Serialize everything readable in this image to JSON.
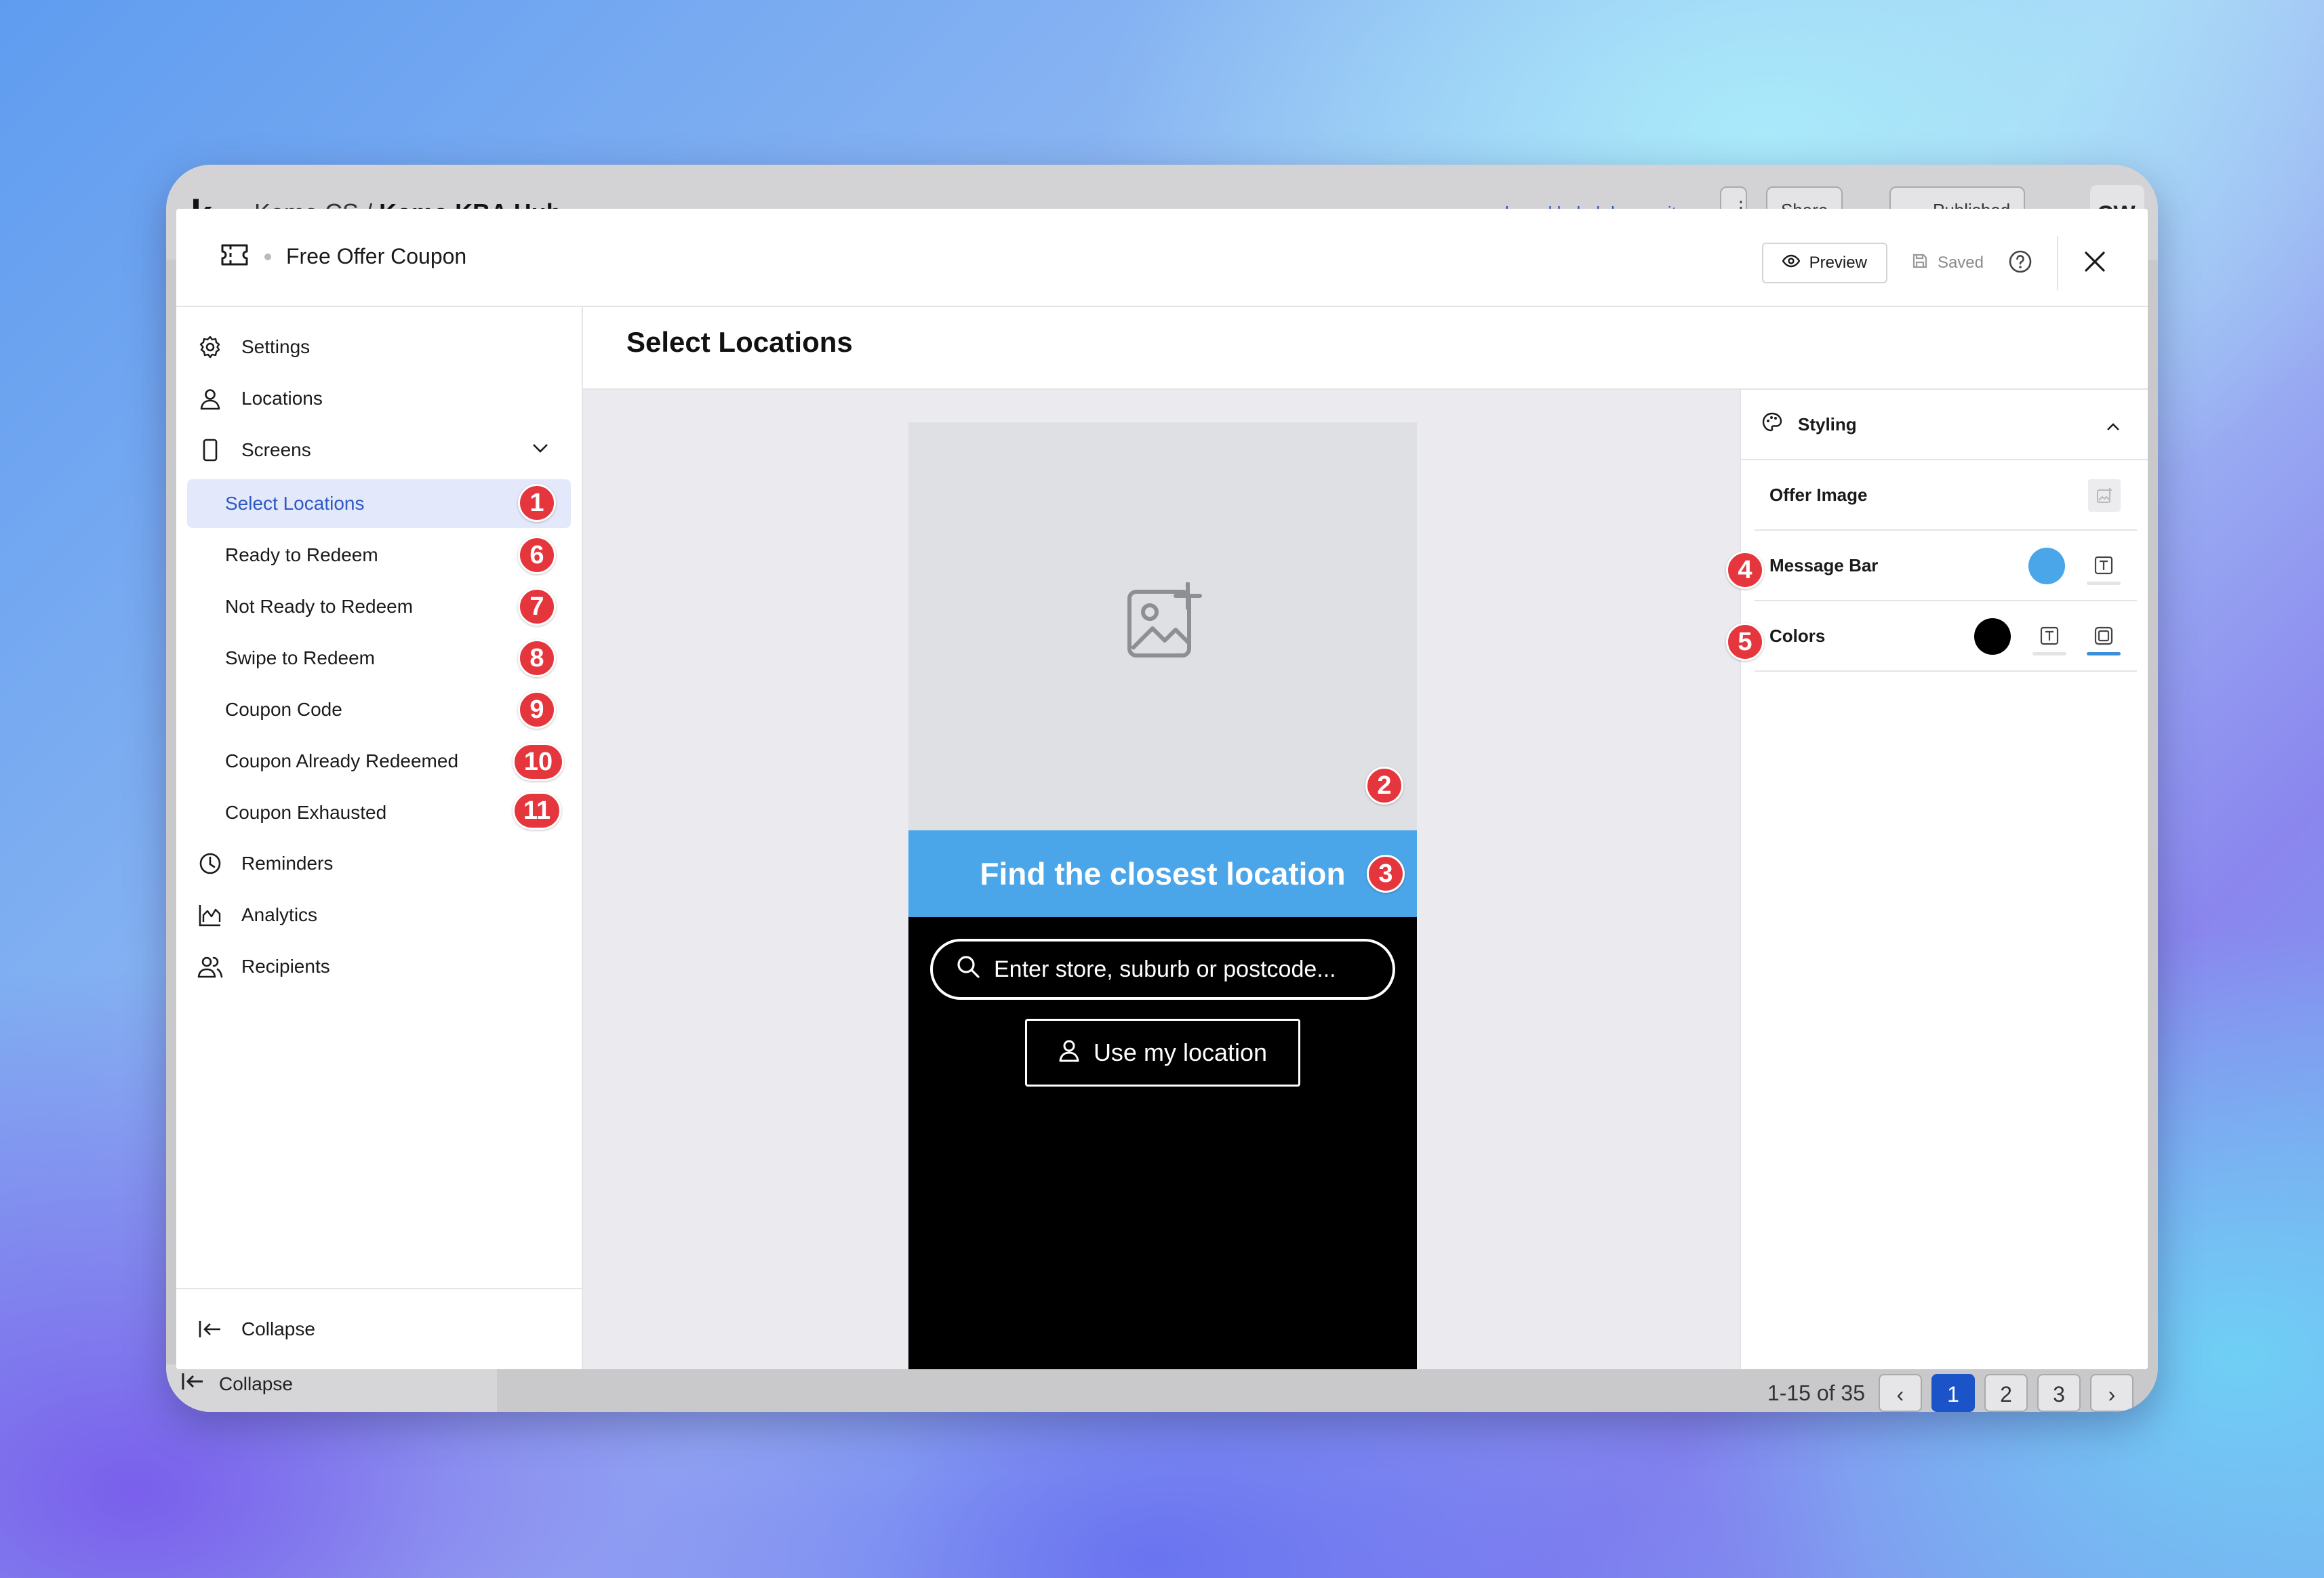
{
  "background_app": {
    "logo": "k",
    "breadcrumb_org": "Komo CS",
    "breadcrumb_sep": "/",
    "breadcrumb_project": "Komo KBA Hub",
    "site_link": "komokbahub.komo.site",
    "share_label": "Share",
    "status_label": "Published",
    "avatar_initials": "CW",
    "collapse_label": "Collapse",
    "pagination": {
      "range": "1-15 of 35",
      "pages": [
        "1",
        "2",
        "3"
      ],
      "current": "1"
    }
  },
  "modal": {
    "title": "Free Offer Coupon",
    "preview_label": "Preview",
    "saved_label": "Saved"
  },
  "sidebar": {
    "items": [
      {
        "label": "Settings",
        "icon": "gear-icon"
      },
      {
        "label": "Locations",
        "icon": "user-pin-icon"
      },
      {
        "label": "Screens",
        "icon": "phone-icon"
      }
    ],
    "screens": [
      {
        "label": "Select Locations",
        "badge": "1",
        "active": true
      },
      {
        "label": "Ready to Redeem",
        "badge": "6"
      },
      {
        "label": "Not Ready to Redeem",
        "badge": "7"
      },
      {
        "label": "Swipe to Redeem",
        "badge": "8"
      },
      {
        "label": "Coupon Code",
        "badge": "9"
      },
      {
        "label": "Coupon Already Redeemed",
        "badge": "10"
      },
      {
        "label": "Coupon Exhausted",
        "badge": "11"
      }
    ],
    "bottom_items": [
      {
        "label": "Reminders",
        "icon": "clock-icon"
      },
      {
        "label": "Analytics",
        "icon": "chart-icon"
      },
      {
        "label": "Recipients",
        "icon": "users-icon"
      }
    ],
    "collapse_label": "Collapse"
  },
  "main": {
    "title": "Select Locations",
    "preview": {
      "image_badge": "2",
      "message_bar_text": "Find the closest location",
      "message_bar_badge": "3",
      "message_bar_color": "#4aa6e9",
      "search_placeholder": "Enter store, suburb or postcode...",
      "use_location_label": "Use my location"
    }
  },
  "styling_panel": {
    "title": "Styling",
    "rows": [
      {
        "label": "Offer Image"
      },
      {
        "label": "Message Bar",
        "badge": "4",
        "color": "#4aa6e9"
      },
      {
        "label": "Colors",
        "badge": "5",
        "color": "#000000"
      }
    ]
  },
  "colors": {
    "badge": "#e5363d",
    "accent": "#2c59c3",
    "active_bg": "#e3e9fb"
  }
}
